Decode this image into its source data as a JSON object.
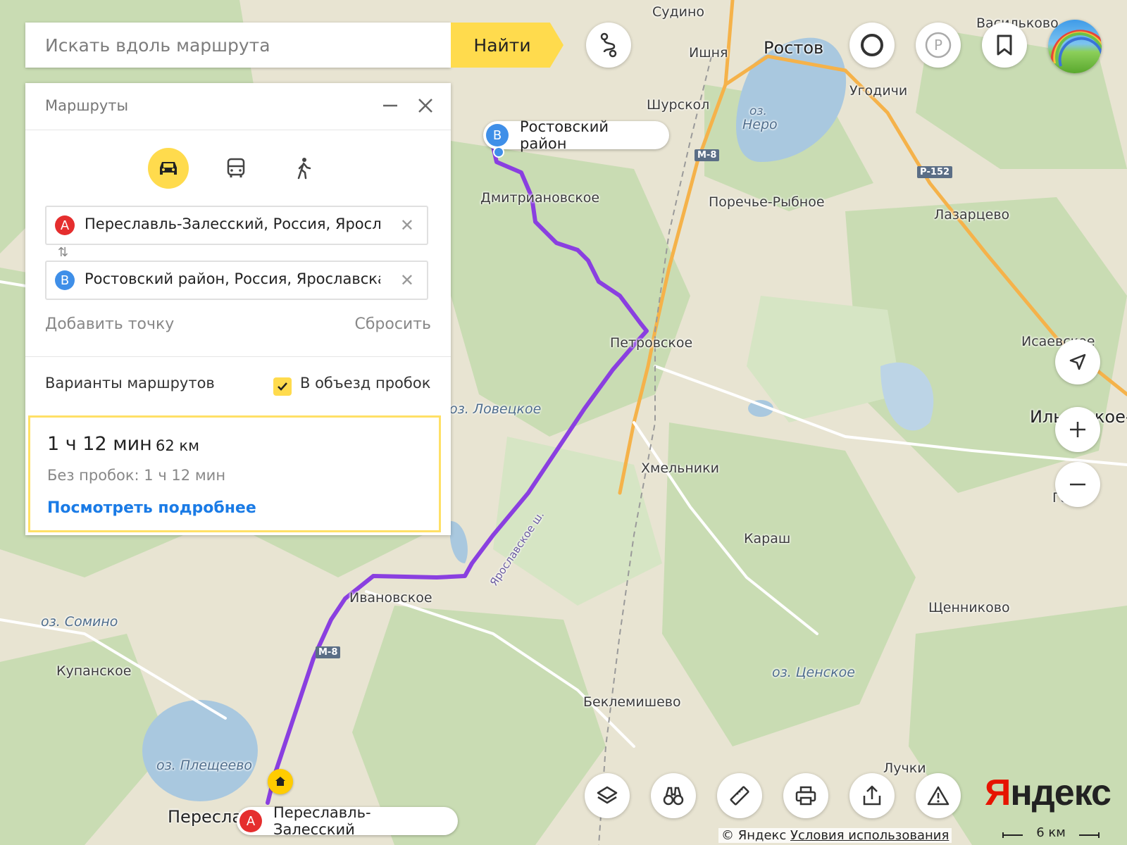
{
  "search": {
    "placeholder": "Искать вдоль маршрута",
    "find_label": "Найти"
  },
  "panel": {
    "title": "Маршруты",
    "point_a": {
      "badge": "A",
      "text": "Переславль-Залесский, Россия, Ярославская область"
    },
    "point_b": {
      "badge": "B",
      "text": "Ростовский район, Россия, Ярославская область"
    },
    "add_point": "Добавить точку",
    "reset": "Сбросить",
    "variants_label": "Варианты маршрутов",
    "avoid_traffic_label": "В объезд пробок",
    "avoid_traffic_checked": true,
    "route": {
      "time": "1 ч 12 мин",
      "distance": "62 км",
      "no_traffic": "Без пробок: 1 ч 12 мин",
      "details_link": "Посмотреть подробнее"
    }
  },
  "markers": {
    "a": {
      "badge": "A",
      "label": "Переславль-Залесский"
    },
    "b": {
      "badge": "B",
      "label": "Ростовский район"
    }
  },
  "map_labels": {
    "sudino": "Судино",
    "ishnya": "Ишня",
    "rostov": "Ростов",
    "vasilkovo": "Васильково",
    "ugodichi": "Угодичи",
    "shurskol": "Шурскол",
    "nero_1": "оз.",
    "nero_2": "Неро",
    "dmitrianovskoe": "Дмитриановское",
    "poreche": "Поречье-Рыбное",
    "lazartsevo": "Лазарцево",
    "petrovskoe": "Петровское",
    "isaevskoe": "Исаевское",
    "lovetskoe": "оз. Ловецкое",
    "ilinskoe": "Ильинское-",
    "khmelniki": "Хмельники",
    "gari": "Гари",
    "karash": "Караш",
    "ivanovskoe": "Ивановское",
    "somino": "оз. Сомино",
    "shchennikovo": "Щенниково",
    "kupanskoe": "Купанское",
    "tsenskoe": "оз. Ценское",
    "beklemishevo": "Беклемишево",
    "pleshcheevo": "оз. Плещеево",
    "luchki": "Лучки",
    "pereslavl": "Переславль",
    "yaroslavskoe_sh": "Ярославское ш."
  },
  "road_shields": {
    "m8_top": "М-8",
    "p152": "Р-152",
    "m8_bottom": "М-8"
  },
  "brand": {
    "logo_y": "Я",
    "logo_rest": "ндекс"
  },
  "footer": {
    "copyright": "© Яндекс",
    "terms": "Условия использования",
    "scale": "6 км"
  },
  "colors": {
    "accent_yellow": "#ffdb4d",
    "route_purple": "#8a3fe0",
    "marker_a": "#e52e2e",
    "marker_b": "#3f8fe8",
    "link_blue": "#1a7be6"
  }
}
